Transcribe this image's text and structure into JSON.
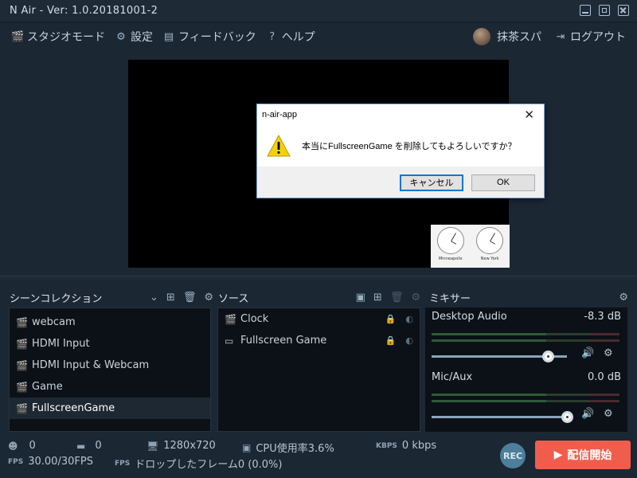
{
  "window": {
    "title": "N Air - Ver: 1.0.20181001-2"
  },
  "nav": {
    "studio_mode": "スタジオモード",
    "settings": "設定",
    "feedback": "フィードバック",
    "help": "ヘルプ",
    "username": "抹茶スパ",
    "logout": "ログアウト"
  },
  "preview": {
    "clocks": [
      {
        "city": "Minneapolis"
      },
      {
        "city": "New York"
      }
    ]
  },
  "scenes": {
    "title": "シーンコレクション",
    "items": [
      "webcam",
      "HDMI Input",
      "HDMI Input & Webcam",
      "Game",
      "FullscreenGame"
    ],
    "selected": "FullscreenGame"
  },
  "sources": {
    "title": "ソース",
    "items": [
      "Clock",
      "Fullscreen Game"
    ]
  },
  "mixer": {
    "title": "ミキサー",
    "channels": [
      {
        "name": "Desktop Audio",
        "level": "-8.3 dB",
        "volume_fraction": 0.86
      },
      {
        "name": "Mic/Aux",
        "level": "0.0 dB",
        "volume_fraction": 1.0
      }
    ]
  },
  "status": {
    "viewers": "0",
    "comments": "0",
    "resolution": "1280x720",
    "cpu": "CPU使用率3.6%",
    "bitrate": "0 kbps",
    "fps": "30.00/30FPS",
    "dropped": "ドロップしたフレーム0 (0.0%)",
    "rec": "REC",
    "go_live": "配信開始"
  },
  "dialog": {
    "title": "n-air-app",
    "message": "本当にFullscreenGame を削除してもよろしいですか？",
    "cancel": "キャンセル",
    "ok": "OK"
  }
}
